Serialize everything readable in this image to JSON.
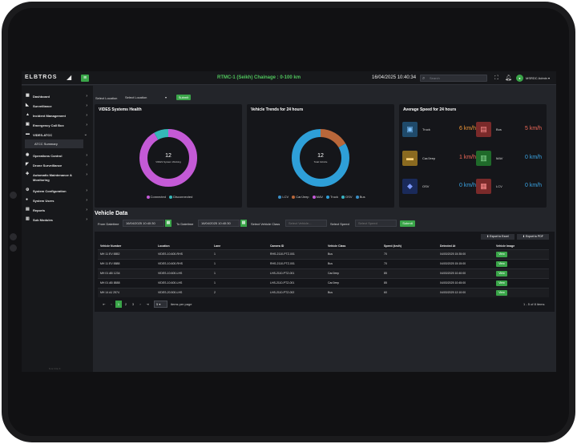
{
  "header": {
    "logo": "ELBTROS",
    "chainage": "RTMC-1 (Seikh) Chainage : 0-100 km",
    "datetime": "16/04/2025 10:40:34",
    "search_placeholder": "Search",
    "user": "MSRDC Admin"
  },
  "sidebar": {
    "items": [
      {
        "label": "Dashboard",
        "icon": "grid-icon"
      },
      {
        "label": "Surveillance",
        "icon": "camera-icon"
      },
      {
        "label": "Incident Management",
        "icon": "alert-icon"
      },
      {
        "label": "Emergency Call Box",
        "icon": "phone-icon"
      },
      {
        "label": "VIDES-ATCC",
        "icon": "car-icon"
      },
      {
        "label": "Operations Control",
        "icon": "control-icon"
      },
      {
        "label": "Drone Surveillance",
        "icon": "drone-icon"
      },
      {
        "label": "Automatic Maintenance & Monitoring",
        "icon": "wrench-icon"
      },
      {
        "label": "System Configuration",
        "icon": "gear-icon"
      },
      {
        "label": "System Users",
        "icon": "users-icon"
      },
      {
        "label": "Reports",
        "icon": "report-icon"
      },
      {
        "label": "Sub Modules",
        "icon": "modules-icon"
      }
    ],
    "sub_item": "ATCC Summary",
    "footer": "NHNEX"
  },
  "location": {
    "label": "Select Location",
    "value": "Select Location",
    "submit": "Submit"
  },
  "cards": {
    "health": {
      "title": "VIDES Systems Health",
      "center_value": "12",
      "center_label": "VIDES System Working",
      "legend": [
        {
          "name": "Connected",
          "color": "#c45ad6"
        },
        {
          "name": "Disconnected",
          "color": "#35b8b8"
        }
      ],
      "segments": [
        {
          "name": "Connected",
          "value": 11,
          "color": "#c45ad6"
        },
        {
          "name": "Disconnected",
          "value": 1,
          "color": "#35b8b8"
        }
      ]
    },
    "trends": {
      "title": "Vehicle Trends for 24 hours",
      "center_value": "12",
      "center_label": "Total Vehicle",
      "legend": [
        {
          "name": "LCV",
          "color": "#3a8fc7"
        },
        {
          "name": "Car/Jeep",
          "color": "#b9673a"
        },
        {
          "name": "MAV",
          "color": "#c45ad6"
        },
        {
          "name": "Truck",
          "color": "#2e9fd8"
        },
        {
          "name": "OSV",
          "color": "#39b3c2"
        },
        {
          "name": "Bus",
          "color": "#3a8fc7"
        }
      ],
      "segments": [
        {
          "name": "Car/Jeep",
          "value": 2,
          "color": "#b9673a"
        },
        {
          "name": "Bus",
          "value": 10,
          "color": "#2e9fd8"
        }
      ]
    },
    "speed": {
      "title": "Average Speed for 24 hours",
      "rows": [
        {
          "name": "Truck",
          "value": "6 km/h",
          "color": "#f59a39",
          "bg": "#1f4a6a",
          "icon": "truck-icon"
        },
        {
          "name": "Bus",
          "value": "5 km/h",
          "color": "#f26a5a",
          "bg": "#7a2a2a",
          "icon": "bus-icon"
        },
        {
          "name": "Car/Jeep",
          "value": "1 km/h",
          "color": "#f26a5a",
          "bg": "#8a6a20",
          "icon": "car-icon"
        },
        {
          "name": "MAV",
          "value": "0 km/h",
          "color": "#3ba7e8",
          "bg": "#1f6a2a",
          "icon": "mav-icon"
        },
        {
          "name": "OSV",
          "value": "0 km/h",
          "color": "#3ba7e8",
          "bg": "#1a2a5a",
          "icon": "osv-icon"
        },
        {
          "name": "LCV",
          "value": "0 km/h",
          "color": "#3ba7e8",
          "bg": "#7a2a2a",
          "icon": "lcv-icon"
        }
      ]
    }
  },
  "vehicle": {
    "title": "Vehicle Data",
    "from_label": "From Datetime",
    "from_value": "16/04/2025 10:40:30",
    "to_label": "To Datetime",
    "to_value": "16/04/2025 10:40:30",
    "class_label": "Select Vehicle Class",
    "class_placeholder": "Select Vehicle...",
    "speed_label": "Select Speed",
    "speed_placeholder": "Select Speed",
    "submit": "Submit",
    "export_excel": "Export to Excel",
    "export_pdf": "Export to PDF",
    "columns": [
      "Vehicle Number",
      "Location",
      "Lane",
      "Camera ID",
      "Vehicle Class",
      "Speed (km/h)",
      "Detected At",
      "Vehicle Image"
    ],
    "rows": [
      [
        "MH 11 EV 8852",
        "VIDES-10.600-RHS",
        "1",
        "RHS-2110-PTZ-001",
        "Bus",
        "70",
        "04/03/2025 15:35:00",
        "View"
      ],
      [
        "MH 11 EV 8888",
        "VIDES-10.600-RHS",
        "1",
        "RHS-2110-PTZ-001",
        "Bus",
        "70",
        "04/03/2025 15:15:00",
        "View"
      ],
      [
        "MH 01 AB 1234",
        "VIDES-10.600-LHS",
        "1",
        "LHS-2110-PTZ-001",
        "Car/Jeep",
        "85",
        "04/03/2025 10:40:00",
        "View"
      ],
      [
        "MH 01 AB 8888",
        "VIDES-10.600-LHS",
        "1",
        "LHS-2110-PTZ-001",
        "Car/Jeep",
        "85",
        "04/03/2025 10:45:00",
        "View"
      ],
      [
        "MH 14 AJ 2574",
        "VIDES-20.500-LHS",
        "2",
        "LHS-2110-PTZ-002",
        "Bus",
        "60",
        "04/03/2025 12:10:00",
        "View"
      ]
    ],
    "pages": [
      "1",
      "2",
      "3"
    ],
    "page_size": "5",
    "items_label": "items per page",
    "range_label": "1 - 5 of 8 items"
  }
}
